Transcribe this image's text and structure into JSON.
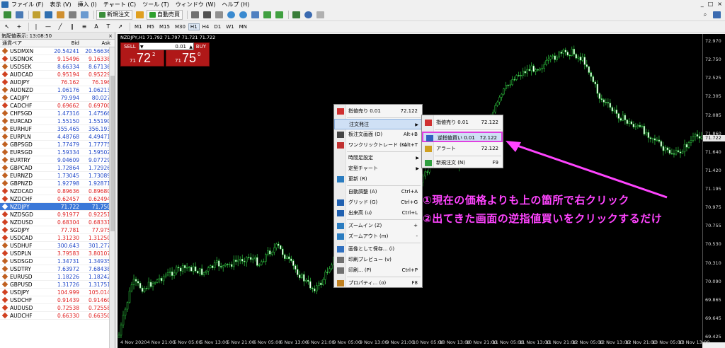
{
  "menu": {
    "items": [
      "ファイル (F)",
      "表示 (V)",
      "挿入 (I)",
      "チャート (C)",
      "ツール (T)",
      "ウィンドウ (W)",
      "ヘルプ (H)"
    ],
    "right_icons": [
      "_",
      "□",
      "×"
    ]
  },
  "toolbar": {
    "new_order": "新規注文",
    "auto_trade": "自動売買",
    "timeframes": [
      "M1",
      "M5",
      "M15",
      "M30",
      "H1",
      "H4",
      "D1",
      "W1",
      "MN"
    ],
    "selected_timeframe": "H1",
    "tool_letters": [
      "A",
      "T"
    ]
  },
  "market_watch": {
    "title": "気配値表示: 13:08:50",
    "close": "×",
    "headers": {
      "symbol": "通貨ペア",
      "bid": "Bid",
      "ask": "Ask"
    },
    "rows": [
      {
        "symbol": "USDMXN",
        "bid": "20.54241",
        "ask": "20.56636",
        "dir": "up"
      },
      {
        "symbol": "USDNOK",
        "bid": "9.15496",
        "ask": "9.16338",
        "dir": "dn"
      },
      {
        "symbol": "USDSEK",
        "bid": "8.66334",
        "ask": "8.67136",
        "dir": "up"
      },
      {
        "symbol": "AUDCAD",
        "bid": "0.95194",
        "ask": "0.95229",
        "dir": "dn"
      },
      {
        "symbol": "AUDJPY",
        "bid": "76.162",
        "ask": "76.196",
        "dir": "dn"
      },
      {
        "symbol": "AUDNZD",
        "bid": "1.06176",
        "ask": "1.06213",
        "dir": "up"
      },
      {
        "symbol": "CADJPY",
        "bid": "79.994",
        "ask": "80.027",
        "dir": "up"
      },
      {
        "symbol": "CADCHF",
        "bid": "0.69662",
        "ask": "0.69700",
        "dir": "dn"
      },
      {
        "symbol": "CHFSGD",
        "bid": "1.47316",
        "ask": "1.47566",
        "dir": "up"
      },
      {
        "symbol": "EURCAD",
        "bid": "1.55150",
        "ask": "1.55190",
        "dir": "up"
      },
      {
        "symbol": "EURHUF",
        "bid": "355.465",
        "ask": "356.193",
        "dir": "up"
      },
      {
        "symbol": "EURPLN",
        "bid": "4.48768",
        "ask": "4.49471",
        "dir": "up"
      },
      {
        "symbol": "GBPSGD",
        "bid": "1.77479",
        "ask": "1.77775",
        "dir": "up"
      },
      {
        "symbol": "EURSGD",
        "bid": "1.59334",
        "ask": "1.59502",
        "dir": "up"
      },
      {
        "symbol": "EURTRY",
        "bid": "9.04609",
        "ask": "9.07729",
        "dir": "up"
      },
      {
        "symbol": "GBPCAD",
        "bid": "1.72864",
        "ask": "1.72926",
        "dir": "up"
      },
      {
        "symbol": "EURNZD",
        "bid": "1.73045",
        "ask": "1.73089",
        "dir": "up"
      },
      {
        "symbol": "GBPNZD",
        "bid": "1.92798",
        "ask": "1.92871",
        "dir": "up"
      },
      {
        "symbol": "NZDCAD",
        "bid": "0.89636",
        "ask": "0.89680",
        "dir": "dn"
      },
      {
        "symbol": "NZDCHF",
        "bid": "0.62457",
        "ask": "0.62494",
        "dir": "dn"
      },
      {
        "symbol": "NZDJPY",
        "bid": "71.722",
        "ask": "71.750",
        "dir": "sel"
      },
      {
        "symbol": "NZDSGD",
        "bid": "0.91977",
        "ask": "0.92251",
        "dir": "dn"
      },
      {
        "symbol": "NZDUSD",
        "bid": "0.68304",
        "ask": "0.68331",
        "dir": "dn"
      },
      {
        "symbol": "SGDJPY",
        "bid": "77.781",
        "ask": "77.975",
        "dir": "dn"
      },
      {
        "symbol": "USDCAD",
        "bid": "1.31230",
        "ask": "1.31250",
        "dir": "dn"
      },
      {
        "symbol": "USDHUF",
        "bid": "300.643",
        "ask": "301.277",
        "dir": "up"
      },
      {
        "symbol": "USDPLN",
        "bid": "3.79583",
        "ask": "3.80107",
        "dir": "dn"
      },
      {
        "symbol": "USDSGD",
        "bid": "1.34731",
        "ask": "1.34935",
        "dir": "up"
      },
      {
        "symbol": "USDTRY",
        "bid": "7.63972",
        "ask": "7.68438",
        "dir": "up"
      },
      {
        "symbol": "EURUSD",
        "bid": "1.18226",
        "ask": "1.18242",
        "dir": "up"
      },
      {
        "symbol": "GBPUSD",
        "bid": "1.31726",
        "ask": "1.31751",
        "dir": "up"
      },
      {
        "symbol": "USDJPY",
        "bid": "104.999",
        "ask": "105.014",
        "dir": "dn"
      },
      {
        "symbol": "USDCHF",
        "bid": "0.91439",
        "ask": "0.91460",
        "dir": "dn"
      },
      {
        "symbol": "AUDUSD",
        "bid": "0.72538",
        "ask": "0.72558",
        "dir": "dn"
      },
      {
        "symbol": "AUDCHF",
        "bid": "0.66330",
        "ask": "0.66350",
        "dir": "dn"
      }
    ]
  },
  "chart": {
    "title": "NZDJPY,H1  71.792 71.797 71.721 71.722",
    "current_price": "71.722",
    "price_ticks": [
      "72.970",
      "72.750",
      "72.525",
      "72.305",
      "72.085",
      "71.860",
      "71.640",
      "71.420",
      "71.195",
      "70.975",
      "70.755",
      "70.530",
      "70.310",
      "70.090",
      "69.865",
      "69.645",
      "69.425"
    ],
    "time_ticks": [
      "4 Nov 2020",
      "4 Nov 21:00",
      "5 Nov 05:00",
      "5 Nov 13:00",
      "5 Nov 21:00",
      "6 Nov 05:00",
      "6 Nov 13:00",
      "6 Nov 21:00",
      "9 Nov 05:00",
      "9 Nov 13:00",
      "9 Nov 21:00",
      "10 Nov 05:00",
      "10 Nov 13:00",
      "10 Nov 21:00",
      "11 Nov 05:00",
      "11 Nov 13:00",
      "11 Nov 21:00",
      "12 Nov 05:00",
      "12 Nov 13:00",
      "12 Nov 21:00",
      "13 Nov 05:00",
      "13 Nov 13:00"
    ]
  },
  "one_click": {
    "sell_label": "SELL",
    "buy_label": "BUY",
    "lot": "0.01",
    "sell_prefix": "71",
    "sell_big": "72",
    "sell_sup": "2",
    "buy_prefix": "71",
    "buy_big": "75",
    "buy_sup": "0"
  },
  "context_menu": {
    "items": [
      {
        "label": "指値売り 0.01",
        "shortcut": "72.122",
        "icon_color": "#d03030"
      },
      {
        "label": "注文発注",
        "shortcut": "",
        "has_sub": true,
        "highlighted": true
      },
      {
        "label": "板注文画面 (D)",
        "shortcut": "Alt+B",
        "icon_color": "#444"
      },
      {
        "label": "ワンクリックトレード (K)",
        "shortcut": "Alt+T",
        "icon_color": "#c03030"
      },
      {
        "label": "時間足設定",
        "shortcut": "",
        "has_sub": true
      },
      {
        "label": "定型チャート",
        "shortcut": "",
        "has_sub": true
      },
      {
        "label": "更新 (R)",
        "shortcut": "",
        "icon_color": "#2a7cc0"
      },
      {
        "label": "自動調整 (A)",
        "shortcut": "Ctrl+A"
      },
      {
        "label": "グリッド (G)",
        "shortcut": "Ctrl+G",
        "icon_color": "#2060b0"
      },
      {
        "label": "出来高 (u)",
        "shortcut": "Ctrl+L",
        "icon_color": "#2060b0"
      },
      {
        "label": "ズームイン (Z)",
        "shortcut": "+",
        "icon_color": "#2a7cc0"
      },
      {
        "label": "ズームアウト (m)",
        "shortcut": "-",
        "icon_color": "#2a7cc0"
      },
      {
        "label": "画像として保存... (i)",
        "shortcut": "",
        "icon_color": "#3070c0"
      },
      {
        "label": "印刷プレビュー (v)",
        "shortcut": "",
        "icon_color": "#707070"
      },
      {
        "label": "印刷... (P)",
        "shortcut": "Ctrl+P",
        "icon_color": "#707070"
      },
      {
        "label": "プロパティ... (o)",
        "shortcut": "F8",
        "icon_color": "#c08020"
      }
    ]
  },
  "submenu": {
    "items": [
      {
        "label": "指値売り 0.01",
        "shortcut": "72.122",
        "icon_color": "#d03030"
      },
      {
        "label": "逆指値買い 0.01",
        "shortcut": "72.122",
        "icon_color": "#3060c0",
        "highlighted": true
      },
      {
        "label": "アラート",
        "shortcut": "72.122",
        "icon_color": "#d0a020"
      },
      {
        "label": "新規注文 (N)",
        "shortcut": "F9",
        "icon_color": "#30a040"
      }
    ]
  },
  "annotation": {
    "line1": "①現在の価格よりも上の箇所で右クリック",
    "line2": "②出てきた画面の逆指値買いをクリックするだけ",
    "color": "#ff44ff"
  },
  "colors": {
    "candle_up": "#2ecc40",
    "candle_down": "#ffffff",
    "sell_bg": "#b01818",
    "highlight_border": "#e040e0"
  }
}
